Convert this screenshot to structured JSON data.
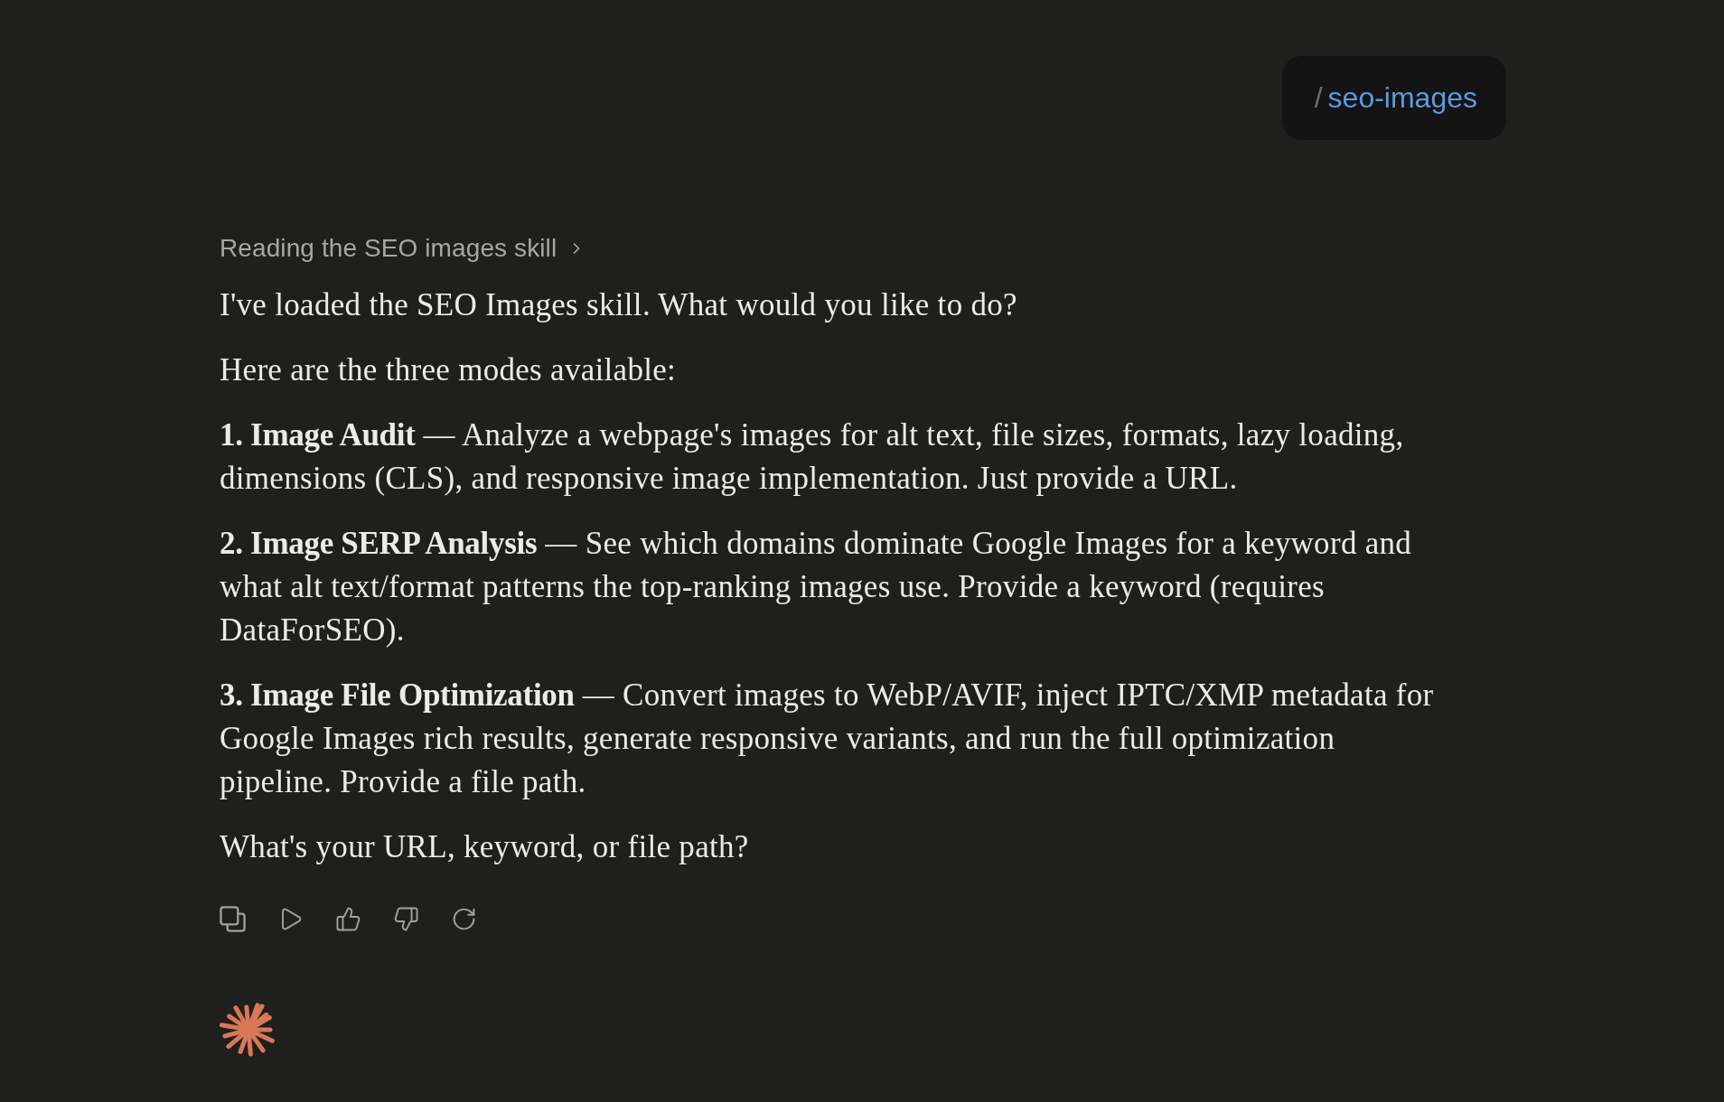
{
  "user_message": {
    "slash": "/",
    "command": "seo-images"
  },
  "assistant_message": {
    "tool_step": {
      "label": "Reading the SEO images skill",
      "expanded": false
    },
    "paragraphs": [
      "I've loaded the SEO Images skill. What would you like to do?",
      "Here are the three modes available:",
      "**1. Image Audit** — Analyze a webpage's images for alt text, file sizes, formats, lazy loading, dimensions (CLS), and responsive image implementation. Just provide a URL.",
      "**2. Image SERP Analysis** — See which domains dominate Google Images for a keyword and what alt text/format patterns the top-ranking images use. Provide a keyword (requires DataForSEO).",
      "**3. Image File Optimization** — Convert images to WebP/AVIF, inject IPTC/XMP metadata for Google Images rich results, generate responsive variants, and run the full optimization pipeline. Provide a file path.",
      "What's your URL, keyword, or file path?"
    ]
  }
}
